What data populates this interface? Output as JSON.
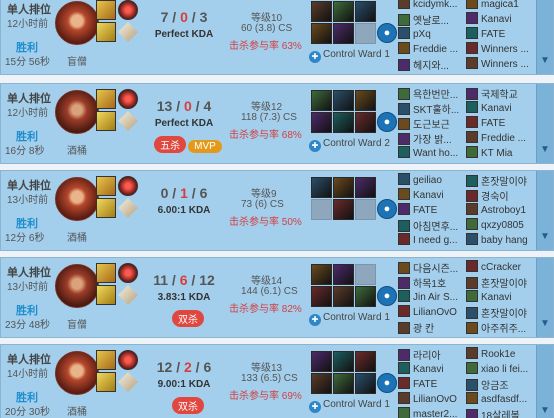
{
  "labels": {
    "kda_suffix": "KDA",
    "control_ward": "Control Ward",
    "kp_prefix": "击杀参与率"
  },
  "matches": [
    {
      "queue": "单人排位",
      "ago": "12小时前",
      "result": "胜利",
      "duration": "15分 56秒",
      "champion": "盲僧",
      "kills": "7",
      "deaths": "0",
      "assists": "3",
      "ratio": "Perfect KDA",
      "badges": [],
      "level": "等级10",
      "cs": "60 (3.8) CS",
      "kp": "击杀参与率 63%",
      "ward": "Control Ward 1",
      "items": [
        true,
        true,
        true,
        true,
        true,
        false,
        true
      ],
      "team_blue": [
        "kcidymk...",
        "옛날로...",
        "pXq",
        "Freddie ...",
        "헤지와..."
      ],
      "team_red": [
        "magica1",
        "Kanavi",
        "FATE",
        "Winners ...",
        "Winners ..."
      ]
    },
    {
      "queue": "单人排位",
      "ago": "12小时前",
      "result": "胜利",
      "duration": "16分 8秒",
      "champion": "酒桶",
      "kills": "13",
      "deaths": "0",
      "assists": "4",
      "ratio": "Perfect KDA",
      "badges": [
        "五杀",
        "MVP"
      ],
      "level": "等级12",
      "cs": "118 (7.3) CS",
      "kp": "击杀参与率 68%",
      "ward": "Control Ward 2",
      "items": [
        true,
        true,
        true,
        true,
        true,
        true,
        true
      ],
      "team_blue": [
        "욕한번만...",
        "SKT훌하...",
        "도근보근",
        "가장 밝...",
        "Want ho..."
      ],
      "team_red": [
        "국제학교",
        "Kanavi",
        "FATE",
        "Freddie ...",
        "KT Mia"
      ]
    },
    {
      "queue": "单人排位",
      "ago": "13小时前",
      "result": "胜利",
      "duration": "12分 6秒",
      "champion": "酒桶",
      "kills": "0",
      "deaths": "1",
      "assists": "6",
      "ratio": "6.00:1 KDA",
      "badges": [],
      "level": "等级9",
      "cs": "73 (6) CS",
      "kp": "击杀参与率 50%",
      "ward": "",
      "items": [
        true,
        true,
        true,
        false,
        true,
        false,
        true
      ],
      "team_blue": [
        "geiliao",
        "Kanavi",
        "FATE",
        "아침면후...",
        "I need g..."
      ],
      "team_red": [
        "혼잣말이야",
        "경숙이",
        "Astroboy1",
        "qxzy0805",
        "baby hang"
      ]
    },
    {
      "queue": "单人排位",
      "ago": "13小时前",
      "result": "胜利",
      "duration": "23分 48秒",
      "champion": "盲僧",
      "kills": "11",
      "deaths": "6",
      "assists": "12",
      "ratio": "3.83:1 KDA",
      "badges": [
        "双杀"
      ],
      "level": "等级14",
      "cs": "144 (6.1) CS",
      "kp": "击杀参与率 82%",
      "ward": "Control Ward 1",
      "items": [
        true,
        true,
        false,
        true,
        true,
        true,
        true
      ],
      "team_blue": [
        "다음시즌...",
        "하목1호",
        "Jin Air S...",
        "LilianOvO",
        "광 칸"
      ],
      "team_red": [
        "cCracker",
        "혼잣말이야",
        "Kanavi",
        "혼잣말이야",
        "아주쥐주..."
      ]
    },
    {
      "queue": "单人排位",
      "ago": "14小时前",
      "result": "胜利",
      "duration": "20分 30秒",
      "champion": "酒桶",
      "kills": "12",
      "deaths": "2",
      "assists": "6",
      "ratio": "9.00:1 KDA",
      "badges": [
        "双杀"
      ],
      "level": "等级13",
      "cs": "133 (6.5) CS",
      "kp": "击杀参与率 69%",
      "ward": "Control Ward 1",
      "items": [
        true,
        true,
        true,
        true,
        true,
        true,
        true
      ],
      "team_blue": [
        "라리아",
        "Kanavi",
        "FATE",
        "LilianOvO",
        "master2..."
      ],
      "team_red": [
        "Rook1e",
        "xiao li fei...",
        "앙금조",
        "asdfasdf...",
        "18살레볼"
      ]
    }
  ],
  "colors": {
    "win_bg": "#a3cfec",
    "win_text": "#1f8ecd",
    "death": "#d33f3f",
    "kp": "#d33f3f",
    "mvp": "#e39a1a",
    "multikill": "#e0473f"
  }
}
